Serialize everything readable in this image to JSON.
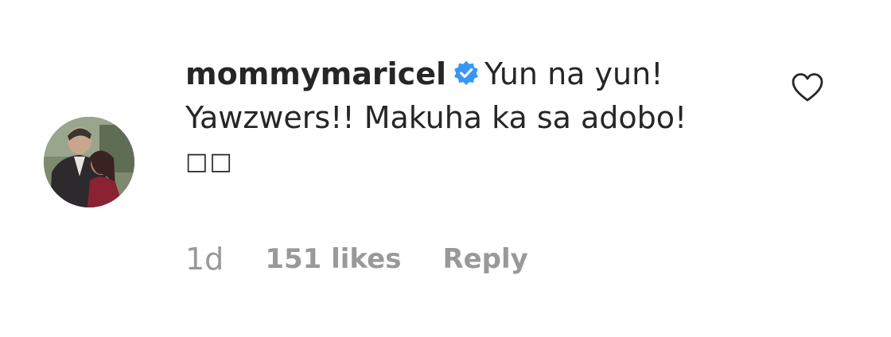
{
  "comment": {
    "username": "mommymaricel",
    "verified_icon": "verified-badge-icon",
    "text_line1": "Yun na yun!",
    "text_line2": "Yawzwers!! Makuha ka sa adobo!",
    "emoji": "□□",
    "timestamp": "1d",
    "likes": "151 likes",
    "reply_label": "Reply",
    "like_icon": "heart-outline-icon",
    "avatar_icon": "profile-photo"
  },
  "colors": {
    "text": "#262626",
    "meta": "#999999",
    "verified": "#3897f0",
    "heart_stroke": "#262626"
  }
}
